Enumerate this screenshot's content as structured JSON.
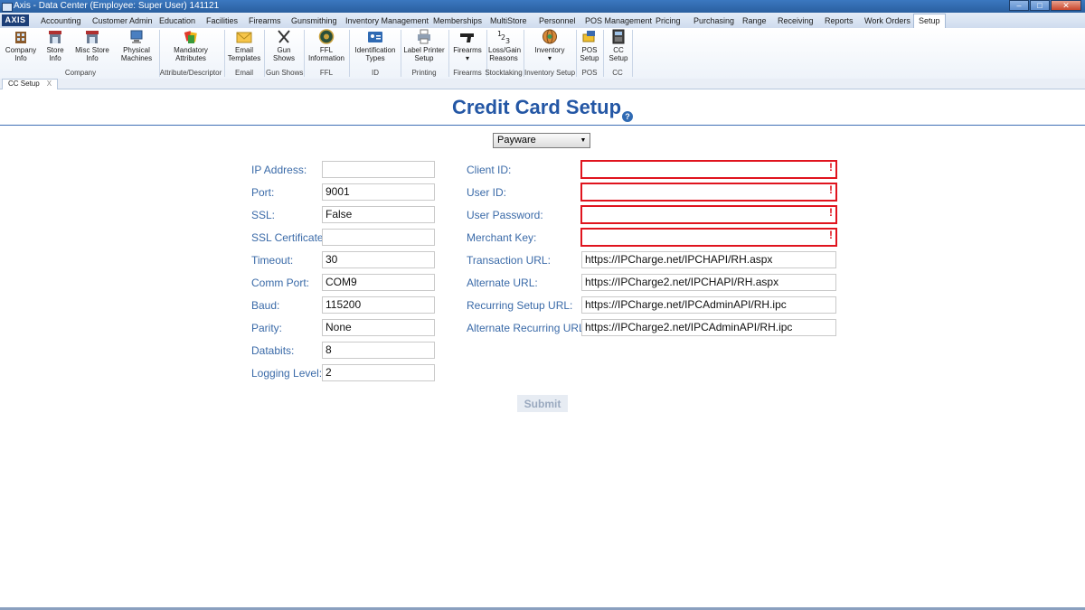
{
  "window": {
    "title": "Axis - Data Center  (Employee: Super User) 141121",
    "min": "–",
    "max": "□",
    "close": "✕"
  },
  "menubar": {
    "logo": "AXIS",
    "tabs": [
      "Accounting",
      "Customer Admin",
      "Education",
      "Facilities",
      "Firearms",
      "Gunsmithing",
      "Inventory Management",
      "Memberships",
      "MultiStore",
      "Personnel",
      "POS Management",
      "Pricing",
      "Purchasing",
      "Range",
      "Receiving",
      "Reports",
      "Work Orders",
      "Setup"
    ],
    "active_tab": "Setup"
  },
  "ribbon": {
    "buttons": [
      {
        "label1": "Company",
        "label2": "Info",
        "icon": "building-icon"
      },
      {
        "label1": "Store",
        "label2": "Info",
        "icon": "store-icon"
      },
      {
        "label1": "Misc Store",
        "label2": "Info",
        "icon": "store-misc-icon"
      },
      {
        "label1": "Physical",
        "label2": "Machines",
        "icon": "computer-icon"
      },
      {
        "label1": "Mandatory",
        "label2": "Attributes",
        "icon": "tags-icon"
      },
      {
        "label1": "Email",
        "label2": "Templates",
        "icon": "envelope-icon"
      },
      {
        "label1": "Gun",
        "label2": "Shows",
        "icon": "crossed-guns-icon"
      },
      {
        "label1": "FFL",
        "label2": "Information",
        "icon": "seal-icon"
      },
      {
        "label1": "Identification",
        "label2": "Types",
        "icon": "id-card-icon"
      },
      {
        "label1": "Label Printer",
        "label2": "Setup",
        "icon": "printer-icon"
      },
      {
        "label1": "Firearms",
        "label2": "▾",
        "icon": "pistol-icon"
      },
      {
        "label1": "Loss/Gain",
        "label2": "Reasons",
        "icon": "numbers-icon"
      },
      {
        "label1": "Inventory",
        "label2": "▾",
        "icon": "globe-icon"
      },
      {
        "label1": "POS",
        "label2": "Setup",
        "icon": "pos-icon"
      },
      {
        "label1": "CC",
        "label2": "Setup",
        "icon": "card-reader-icon"
      }
    ],
    "groups": [
      "Company",
      "Attribute/Descriptor",
      "Email",
      "Gun Shows",
      "FFL",
      "ID",
      "Printing",
      "Firearms",
      "Stocktaking",
      "Inventory Setup",
      "POS",
      "CC"
    ]
  },
  "doc_tab": {
    "label": "CC Setup",
    "close": "X"
  },
  "page": {
    "title": "Credit Card Setup",
    "help": "?",
    "provider": "Payware",
    "submit": "Submit"
  },
  "left_fields": [
    {
      "label": "IP Address:",
      "value": ""
    },
    {
      "label": "Port:",
      "value": "9001"
    },
    {
      "label": "SSL:",
      "value": "False"
    },
    {
      "label": "SSL Certificate:",
      "value": ""
    },
    {
      "label": "Timeout:",
      "value": "30"
    },
    {
      "label": "Comm Port:",
      "value": "COM9"
    },
    {
      "label": "Baud:",
      "value": "115200"
    },
    {
      "label": "Parity:",
      "value": "None"
    },
    {
      "label": "Databits:",
      "value": "8"
    },
    {
      "label": "Logging Level:",
      "value": "2"
    }
  ],
  "right_fields": [
    {
      "label": "Client ID:",
      "value": "",
      "error": "!"
    },
    {
      "label": "User ID:",
      "value": "",
      "error": "!"
    },
    {
      "label": "User Password:",
      "value": "",
      "error": "!"
    },
    {
      "label": "Merchant Key:",
      "value": "",
      "error": "!"
    },
    {
      "label": "Transaction URL:",
      "value": "https://IPCharge.net/IPCHAPI/RH.aspx"
    },
    {
      "label": "Alternate URL:",
      "value": "https://IPCharge2.net/IPCHAPI/RH.aspx"
    },
    {
      "label": "Recurring Setup URL:",
      "value": "https://IPCharge.net/IPCAdminAPI/RH.ipc"
    },
    {
      "label": "Alternate Recurring URL:",
      "value": "https://IPCharge2.net/IPCAdminAPI/RH.ipc"
    }
  ]
}
